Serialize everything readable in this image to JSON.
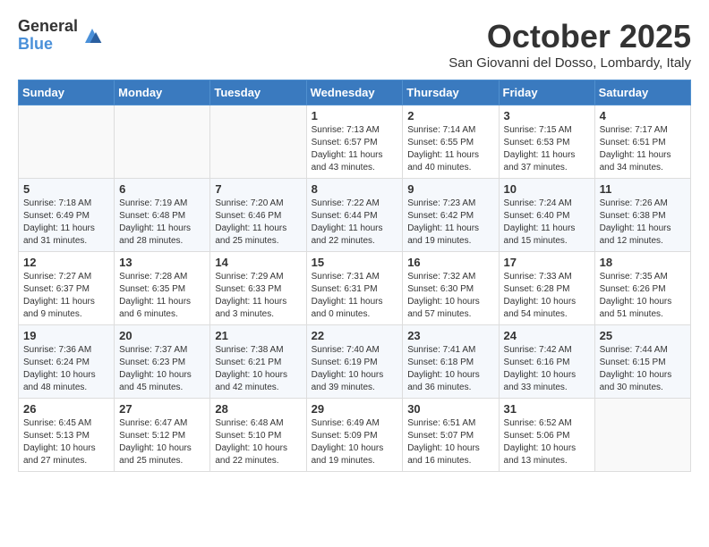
{
  "header": {
    "logo_general": "General",
    "logo_blue": "Blue",
    "month_title": "October 2025",
    "subtitle": "San Giovanni del Dosso, Lombardy, Italy"
  },
  "days_of_week": [
    "Sunday",
    "Monday",
    "Tuesday",
    "Wednesday",
    "Thursday",
    "Friday",
    "Saturday"
  ],
  "weeks": [
    [
      {
        "day": "",
        "info": ""
      },
      {
        "day": "",
        "info": ""
      },
      {
        "day": "",
        "info": ""
      },
      {
        "day": "1",
        "info": "Sunrise: 7:13 AM\nSunset: 6:57 PM\nDaylight: 11 hours\nand 43 minutes."
      },
      {
        "day": "2",
        "info": "Sunrise: 7:14 AM\nSunset: 6:55 PM\nDaylight: 11 hours\nand 40 minutes."
      },
      {
        "day": "3",
        "info": "Sunrise: 7:15 AM\nSunset: 6:53 PM\nDaylight: 11 hours\nand 37 minutes."
      },
      {
        "day": "4",
        "info": "Sunrise: 7:17 AM\nSunset: 6:51 PM\nDaylight: 11 hours\nand 34 minutes."
      }
    ],
    [
      {
        "day": "5",
        "info": "Sunrise: 7:18 AM\nSunset: 6:49 PM\nDaylight: 11 hours\nand 31 minutes."
      },
      {
        "day": "6",
        "info": "Sunrise: 7:19 AM\nSunset: 6:48 PM\nDaylight: 11 hours\nand 28 minutes."
      },
      {
        "day": "7",
        "info": "Sunrise: 7:20 AM\nSunset: 6:46 PM\nDaylight: 11 hours\nand 25 minutes."
      },
      {
        "day": "8",
        "info": "Sunrise: 7:22 AM\nSunset: 6:44 PM\nDaylight: 11 hours\nand 22 minutes."
      },
      {
        "day": "9",
        "info": "Sunrise: 7:23 AM\nSunset: 6:42 PM\nDaylight: 11 hours\nand 19 minutes."
      },
      {
        "day": "10",
        "info": "Sunrise: 7:24 AM\nSunset: 6:40 PM\nDaylight: 11 hours\nand 15 minutes."
      },
      {
        "day": "11",
        "info": "Sunrise: 7:26 AM\nSunset: 6:38 PM\nDaylight: 11 hours\nand 12 minutes."
      }
    ],
    [
      {
        "day": "12",
        "info": "Sunrise: 7:27 AM\nSunset: 6:37 PM\nDaylight: 11 hours\nand 9 minutes."
      },
      {
        "day": "13",
        "info": "Sunrise: 7:28 AM\nSunset: 6:35 PM\nDaylight: 11 hours\nand 6 minutes."
      },
      {
        "day": "14",
        "info": "Sunrise: 7:29 AM\nSunset: 6:33 PM\nDaylight: 11 hours\nand 3 minutes."
      },
      {
        "day": "15",
        "info": "Sunrise: 7:31 AM\nSunset: 6:31 PM\nDaylight: 11 hours\nand 0 minutes."
      },
      {
        "day": "16",
        "info": "Sunrise: 7:32 AM\nSunset: 6:30 PM\nDaylight: 10 hours\nand 57 minutes."
      },
      {
        "day": "17",
        "info": "Sunrise: 7:33 AM\nSunset: 6:28 PM\nDaylight: 10 hours\nand 54 minutes."
      },
      {
        "day": "18",
        "info": "Sunrise: 7:35 AM\nSunset: 6:26 PM\nDaylight: 10 hours\nand 51 minutes."
      }
    ],
    [
      {
        "day": "19",
        "info": "Sunrise: 7:36 AM\nSunset: 6:24 PM\nDaylight: 10 hours\nand 48 minutes."
      },
      {
        "day": "20",
        "info": "Sunrise: 7:37 AM\nSunset: 6:23 PM\nDaylight: 10 hours\nand 45 minutes."
      },
      {
        "day": "21",
        "info": "Sunrise: 7:38 AM\nSunset: 6:21 PM\nDaylight: 10 hours\nand 42 minutes."
      },
      {
        "day": "22",
        "info": "Sunrise: 7:40 AM\nSunset: 6:19 PM\nDaylight: 10 hours\nand 39 minutes."
      },
      {
        "day": "23",
        "info": "Sunrise: 7:41 AM\nSunset: 6:18 PM\nDaylight: 10 hours\nand 36 minutes."
      },
      {
        "day": "24",
        "info": "Sunrise: 7:42 AM\nSunset: 6:16 PM\nDaylight: 10 hours\nand 33 minutes."
      },
      {
        "day": "25",
        "info": "Sunrise: 7:44 AM\nSunset: 6:15 PM\nDaylight: 10 hours\nand 30 minutes."
      }
    ],
    [
      {
        "day": "26",
        "info": "Sunrise: 6:45 AM\nSunset: 5:13 PM\nDaylight: 10 hours\nand 27 minutes."
      },
      {
        "day": "27",
        "info": "Sunrise: 6:47 AM\nSunset: 5:12 PM\nDaylight: 10 hours\nand 25 minutes."
      },
      {
        "day": "28",
        "info": "Sunrise: 6:48 AM\nSunset: 5:10 PM\nDaylight: 10 hours\nand 22 minutes."
      },
      {
        "day": "29",
        "info": "Sunrise: 6:49 AM\nSunset: 5:09 PM\nDaylight: 10 hours\nand 19 minutes."
      },
      {
        "day": "30",
        "info": "Sunrise: 6:51 AM\nSunset: 5:07 PM\nDaylight: 10 hours\nand 16 minutes."
      },
      {
        "day": "31",
        "info": "Sunrise: 6:52 AM\nSunset: 5:06 PM\nDaylight: 10 hours\nand 13 minutes."
      },
      {
        "day": "",
        "info": ""
      }
    ]
  ]
}
